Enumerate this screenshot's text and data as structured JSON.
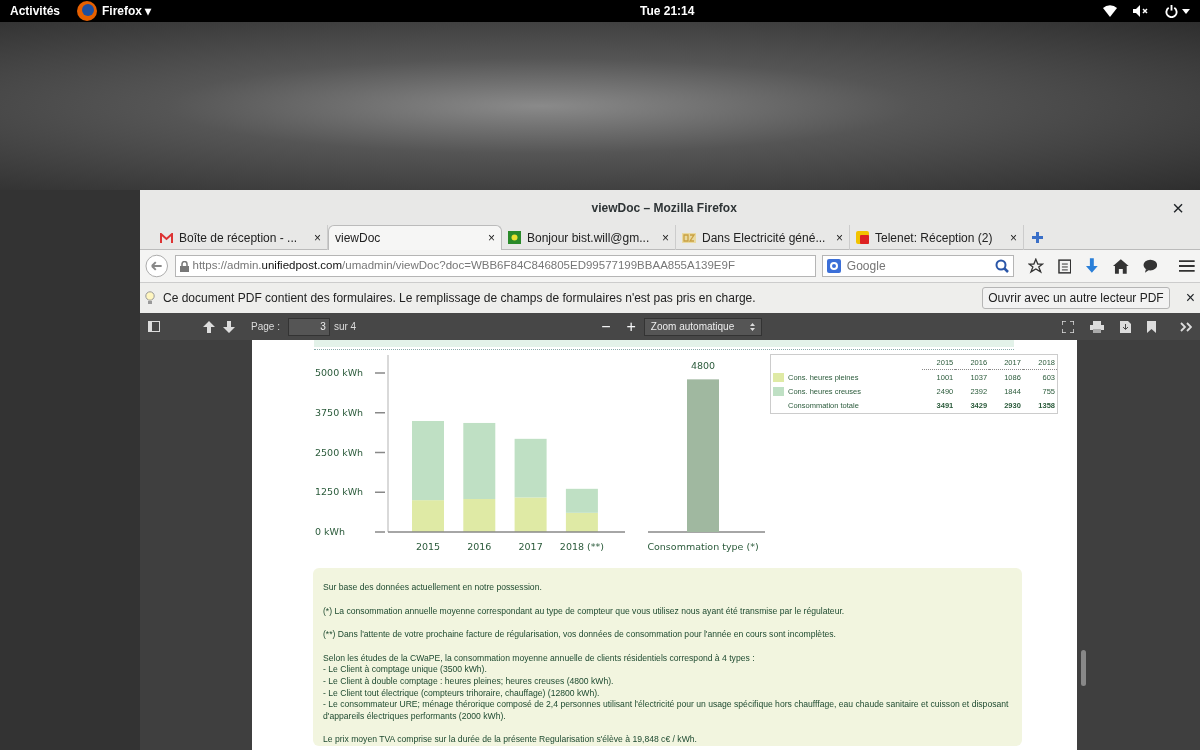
{
  "top_bar": {
    "activities": "Activités",
    "app": "Firefox",
    "app_caret": "▾",
    "clock": "Tue 21:14"
  },
  "window": {
    "title": "viewDoc – Mozilla Firefox",
    "close": "×"
  },
  "tabs": [
    {
      "label": "Boîte de réception - ...",
      "kind": "mail",
      "selected": false,
      "close": "×"
    },
    {
      "label": "viewDoc",
      "kind": "none",
      "selected": true,
      "close": "×"
    },
    {
      "label": "Bonjour bist.will@gm...",
      "kind": "square",
      "selected": false,
      "close": "×"
    },
    {
      "label": "Dans Electricité géné...",
      "kind": "bz",
      "selected": false,
      "close": "×"
    },
    {
      "label": "Telenet: Réception (2)",
      "kind": "badge",
      "selected": false,
      "close": "×"
    }
  ],
  "address": {
    "prefix": "https://admin.",
    "domain": "unifiedpost.com",
    "suffix": "/umadmin/viewDoc?doc=WBB6F84C846805ED99577199BBAA855A139E9F",
    "search_placeholder": "Google"
  },
  "notification": {
    "text": "Ce document PDF contient des formulaires. Le remplissage de champs de formulaires n'est pas pris en charge.",
    "button": "Ouvrir avec un autre lecteur PDF",
    "close": "×"
  },
  "pdf_toolbar": {
    "page_label": "Page :",
    "page": "3",
    "of": "sur 4",
    "minus": "−",
    "plus": "+",
    "zoom": "Zoom automatique"
  },
  "chart": {
    "chart_data": {
      "type": "bar",
      "stacked": true,
      "categories": [
        "2015",
        "2016",
        "2017",
        "2018 (**)"
      ],
      "series": [
        {
          "color": "#dfeaa5",
          "values": [
            1001,
            1037,
            1086,
            603
          ]
        },
        {
          "color": "#bfe0c4",
          "values": [
            2490,
            2392,
            1844,
            755
          ]
        }
      ],
      "ylim": [
        0,
        5000
      ],
      "yticks": [
        {
          "value": 0,
          "label": "0 kWh"
        },
        {
          "value": 1250,
          "label": "1250 kWh"
        },
        {
          "value": 2500,
          "label": "2500 kWh"
        },
        {
          "value": 3750,
          "label": "3750 kWh"
        },
        {
          "value": 5000,
          "label": "5000 kWh"
        }
      ]
    }
  },
  "type_chart": {
    "chart_data": {
      "type": "bar",
      "categories": [
        "Consommation type (*)"
      ],
      "series": [
        {
          "color": "#a0b8a0",
          "values": [
            4800
          ]
        }
      ],
      "ylim": [
        0,
        5000
      ],
      "data_labels": true
    }
  },
  "legend_table": {
    "columns": [
      "2015",
      "2016",
      "2017",
      "2018"
    ],
    "rows": [
      {
        "label": "Cons. heures pleines",
        "color": "#dfeaa5",
        "values": [
          "1001",
          "1037",
          "1086",
          "603"
        ],
        "bold": false
      },
      {
        "label": "Cons. heures creuses",
        "color": "#bfe0c4",
        "values": [
          "2490",
          "2392",
          "1844",
          "755"
        ],
        "bold": false
      },
      {
        "label": "Consommation totale",
        "values": [
          "3491",
          "3429",
          "2930",
          "1358"
        ],
        "bold": true
      }
    ]
  },
  "notes": [
    {
      "lines": [
        "Sur base des données actuellement en notre possession."
      ]
    },
    {
      "lines": [
        "(*) La consommation annuelle moyenne correspondant au type de compteur que vous utilisez nous ayant été transmise par le régulateur."
      ]
    },
    {
      "lines": [
        "(**) Dans l'attente de votre prochaine facture de régularisation, vos données de consommation pour l'année en cours sont incomplètes."
      ]
    },
    {
      "lines": [
        "Selon les études de la CWaPE, la consommation moyenne annuelle de clients résidentiels correspond à 4 types :",
        "- Le Client à comptage unique (3500 kWh).",
        "- Le Client à double comptage : heures pleines; heures creuses (4800 kWh).",
        "- Le Client tout électrique (compteurs trihoraire, chauffage) (12800 kWh).",
        "- Le consommateur URE; ménage thérorique composé de 2,4 personnes utilisant l'électricité pour un usage spécifique hors chaufffage, eau chaude sanitaire et cuisson et disposant d'appareils électriques performants (2000 kWh)."
      ]
    },
    {
      "lines": [
        "Le prix moyen TVA comprise sur la durée de la présente Regularisation s'élève à 19,848 c€ / kWh."
      ]
    }
  ]
}
